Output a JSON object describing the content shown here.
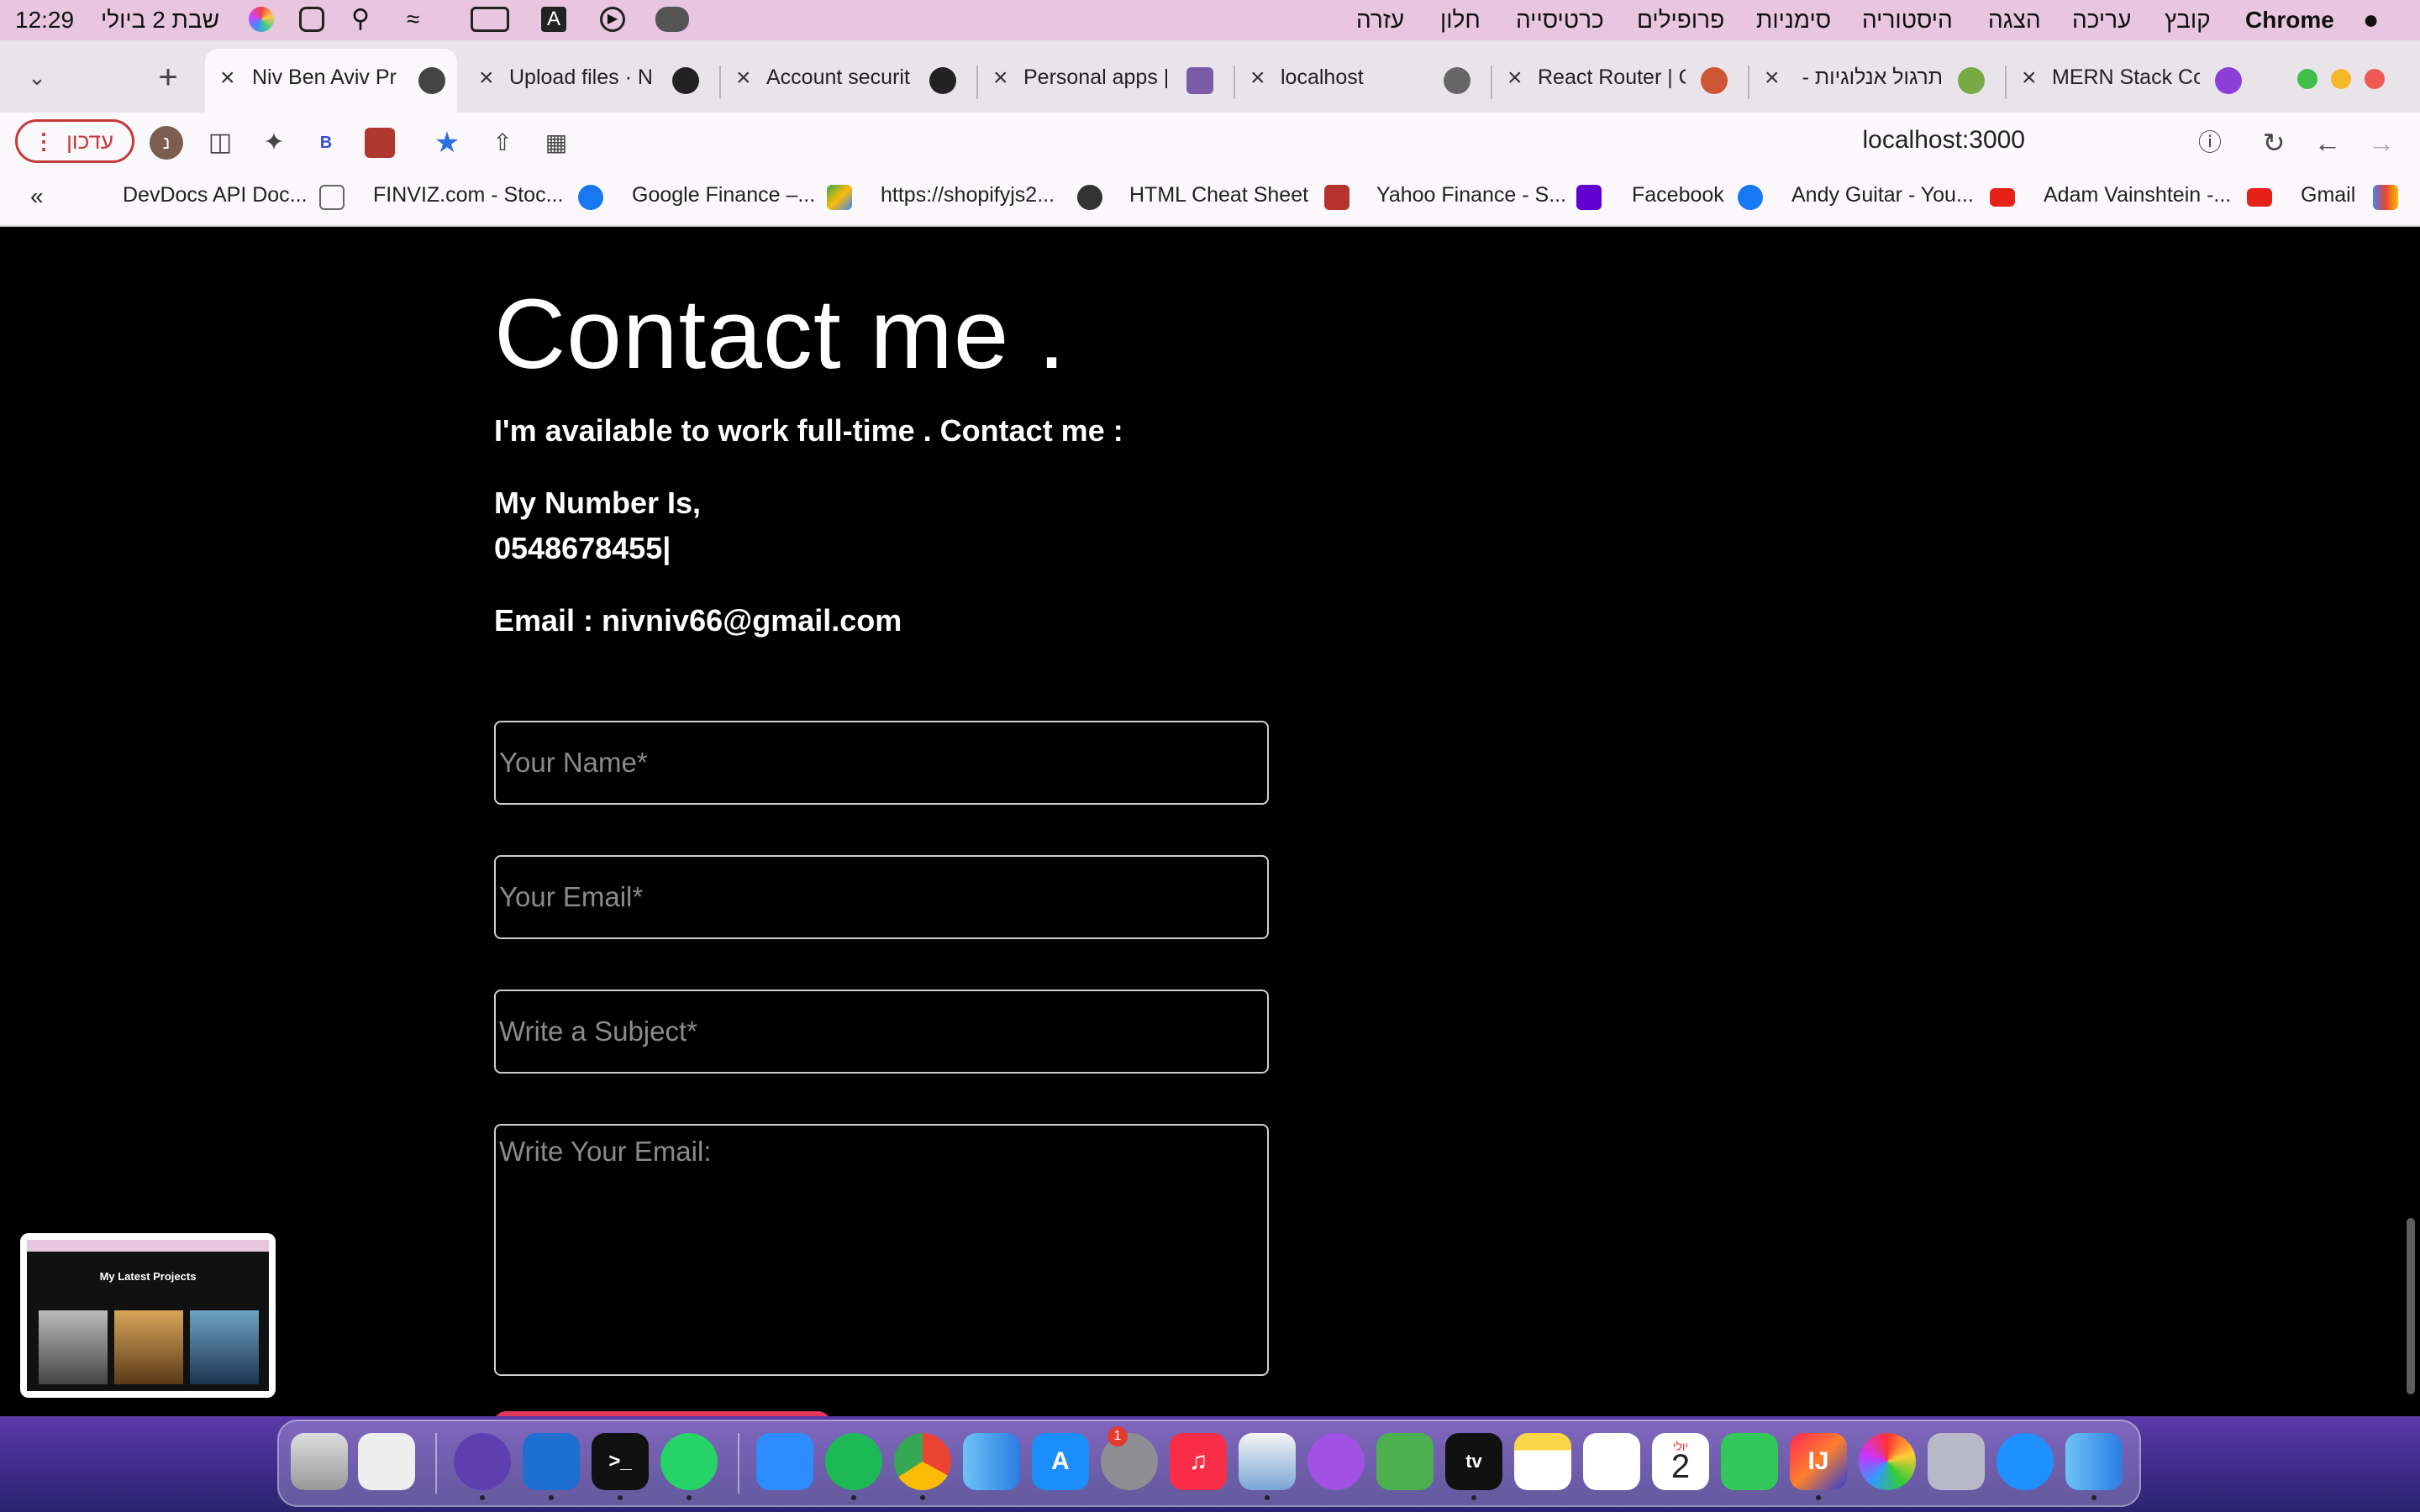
{
  "menubar": {
    "time": "12:29",
    "date": "שבת 2 ביולי",
    "menus": [
      "עזרה",
      "חלון",
      "כרטיסייה",
      "פרופילים",
      "סימניות",
      "היסטוריה",
      "הצגה",
      "עריכה",
      "קובץ"
    ],
    "app_name": "Chrome"
  },
  "tabs": [
    {
      "title": "Niv Ben Aviv Pr",
      "active": true
    },
    {
      "title": "Upload files · N",
      "active": false
    },
    {
      "title": "Account securit",
      "active": false
    },
    {
      "title": "Personal apps |",
      "active": false
    },
    {
      "title": "localhost",
      "active": false
    },
    {
      "title": "React Router | C",
      "active": false
    },
    {
      "title": "תרגול אנלוגיות -",
      "active": false
    },
    {
      "title": "MERN Stack Co",
      "active": false
    }
  ],
  "toolbar": {
    "update_label": "עדכון",
    "avatar_letter": "נ",
    "extension_letter": "B",
    "address": "localhost:3000"
  },
  "bookmarks": [
    {
      "label": "DevDocs API Doc..."
    },
    {
      "label": "FINVIZ.com - Stoc..."
    },
    {
      "label": "Google Finance –..."
    },
    {
      "label": "https://shopifyjs2..."
    },
    {
      "label": "HTML Cheat Sheet"
    },
    {
      "label": "Yahoo Finance - S..."
    },
    {
      "label": "Facebook"
    },
    {
      "label": "Andy Guitar - You..."
    },
    {
      "label": "Adam Vainshtein -..."
    },
    {
      "label": "Gmail"
    }
  ],
  "bookmarks_more": "«",
  "contact": {
    "title": "Contact me .",
    "subtitle": "I'm available to work full-time . Contact me :",
    "number_label": "My Number Is,",
    "number": "0548678455|",
    "email_line": "Email : nivniv66@gmail.com",
    "name_placeholder": "Your Name*",
    "email_placeholder": "Your Email*",
    "subject_placeholder": "Write a Subject*",
    "message_placeholder": "Write Your Email:"
  },
  "pip": {
    "title": "My Latest Projects"
  },
  "dock": {
    "calendar_day": "2",
    "calendar_month": "יולי",
    "settings_badge": "1"
  },
  "colors": {
    "page_bg": "#000000",
    "accent": "#e2365b",
    "menubar": "#e8c6df"
  }
}
